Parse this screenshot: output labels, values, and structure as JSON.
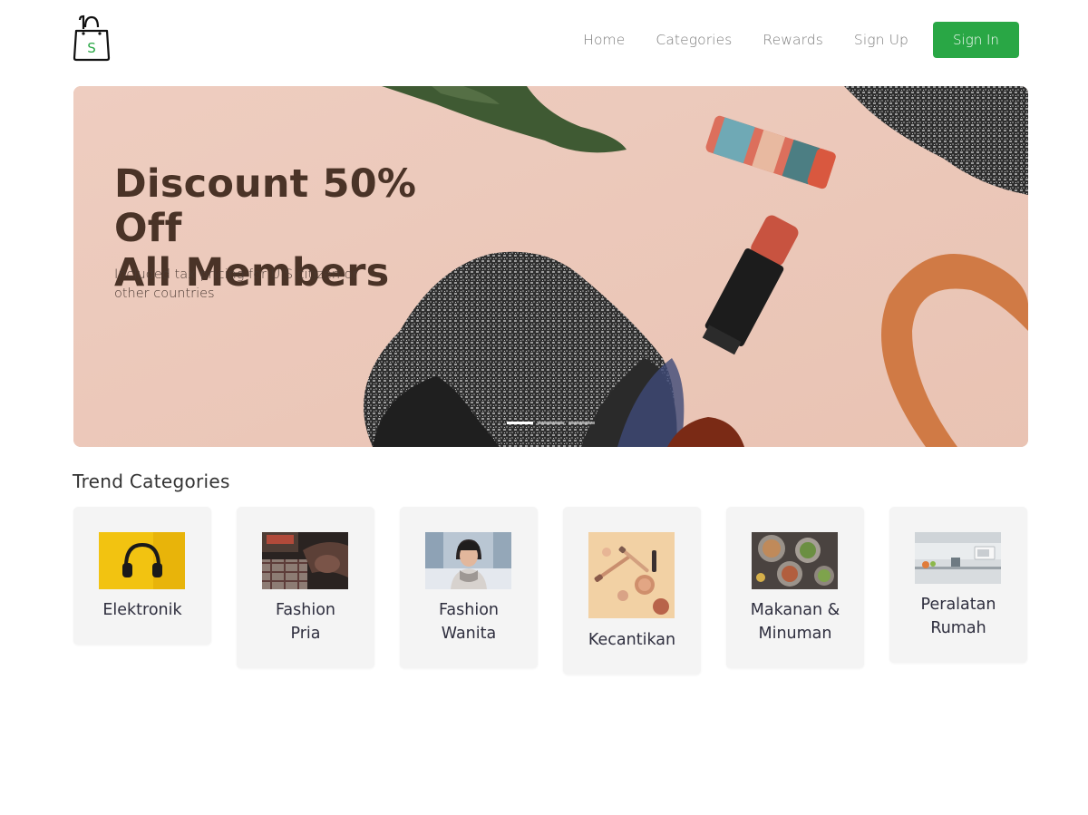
{
  "brand": {
    "logo_letter": "S",
    "logo_color": "#29a745"
  },
  "nav": {
    "items": [
      {
        "label": "Home"
      },
      {
        "label": "Categories"
      },
      {
        "label": "Rewards"
      },
      {
        "label": "Sign Up"
      }
    ],
    "signin_label": "Sign In",
    "accent": "#29a745"
  },
  "hero": {
    "title": "Discount 50% Off\nAll Members",
    "subtitle": "Included tax pricing for U.S citizen or other countries",
    "slides_total": 3,
    "active_slide": 1
  },
  "categories": {
    "title": "Trend Categories",
    "items": [
      {
        "label": "Elektronik",
        "icon": "headphones-image"
      },
      {
        "label": "Fashion\nPria",
        "icon": "mens-fashion-image"
      },
      {
        "label": "Fashion\nWanita",
        "icon": "womens-fashion-image"
      },
      {
        "label": "Kecantikan",
        "icon": "beauty-products-image"
      },
      {
        "label": "Makanan &\nMinuman",
        "icon": "food-drinks-image"
      },
      {
        "label": "Peralatan\nRumah",
        "icon": "kitchen-appliances-image"
      }
    ]
  }
}
